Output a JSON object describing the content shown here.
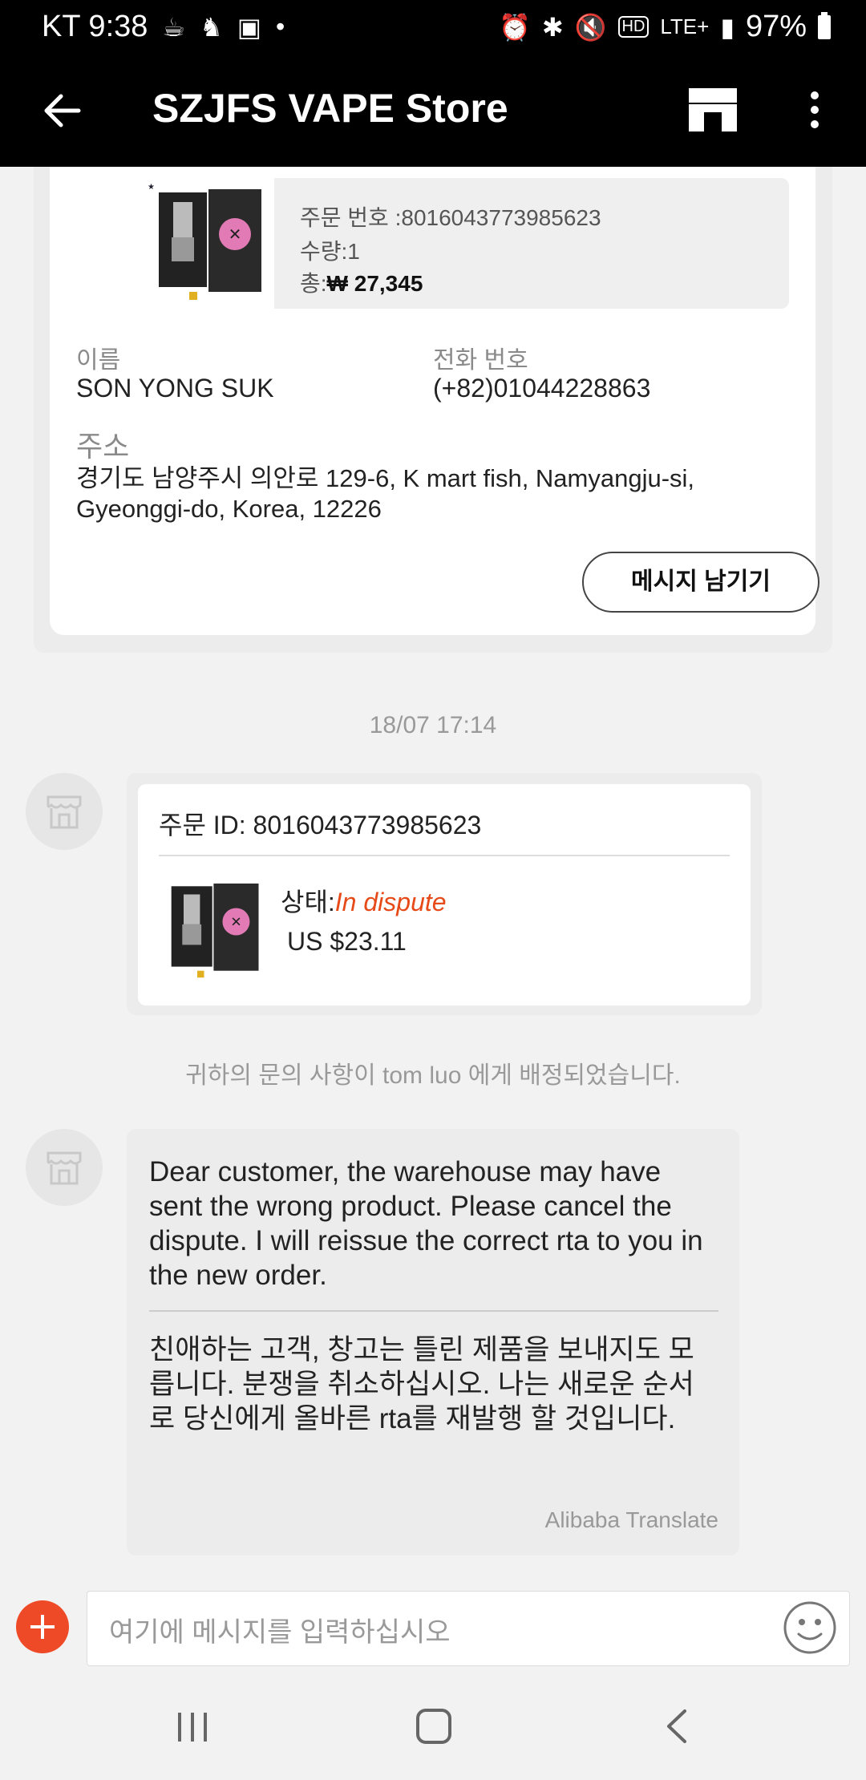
{
  "status_bar": {
    "carrier_time": "KT 9:38",
    "network": "LTE+",
    "battery": "97%"
  },
  "header": {
    "title": "SZJFS VAPE Store"
  },
  "order_card": {
    "order_no_line": "주문 번호 :8016043773985623",
    "qty_line": "수량:1",
    "total_prefix": "총:",
    "total_value": "₩ 27,345",
    "name_label": "이름",
    "name_value": "SON YONG SUK",
    "phone_label": "전화 번호",
    "phone_value": "(+82)01044228863",
    "address_label": "주소",
    "address_value": "경기도 남양주시 의안로 129-6, K mart fish, Namyangju-si, Gyeonggi-do, Korea, 12226",
    "message_button": "메시지 남기기"
  },
  "chat": {
    "timestamp": "18/07 17:14",
    "dispute_card": {
      "order_id": "주문 ID: 8016043773985623",
      "status_label": "상태:",
      "status_value": "In dispute",
      "price": "US $23.11"
    },
    "system_note": "귀하의 문의 사항이 tom luo 에게 배정되었습니다.",
    "message": {
      "english": "Dear customer, the warehouse may have sent the wrong product. Please cancel the dispute. I will reissue the correct rta to you in the new order.",
      "korean": "친애하는 고객, 창고는 틀린 제품을 보내지도 모릅니다. 분쟁을 취소하십시오. 나는 새로운 순서로 당신에게 올바른 rta를 재발행 할 것입니다.",
      "translate_tag": "Alibaba Translate"
    }
  },
  "input_bar": {
    "placeholder": "여기에 메시지를 입력하십시오"
  },
  "colors": {
    "accent": "#ef4a27",
    "dispute_status": "#e64a19"
  }
}
